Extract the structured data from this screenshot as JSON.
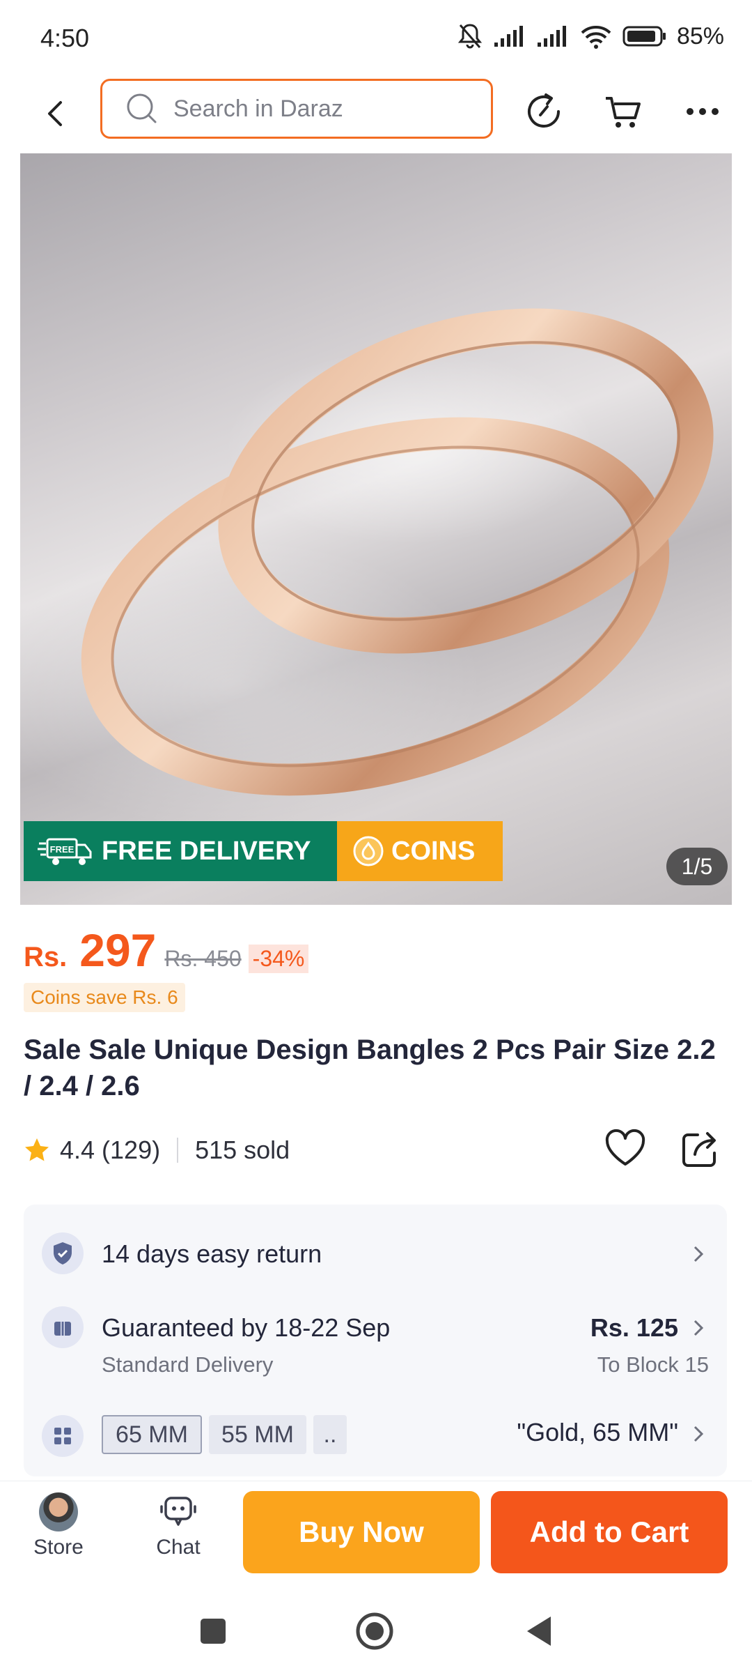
{
  "status_bar": {
    "time": "4:50",
    "battery": "85%",
    "icons": [
      "mute-icon",
      "signal-icon",
      "signal-icon",
      "wifi-icon",
      "battery-icon"
    ]
  },
  "header": {
    "back_icon": "chevron-left-icon",
    "search_placeholder": "Search in Daraz",
    "icons": [
      "history-icon",
      "cart-icon",
      "more-icon"
    ],
    "accent": "#f36d22"
  },
  "gallery": {
    "promo_free_delivery": "FREE DELIVERY",
    "promo_free_tag": "FREE",
    "promo_coins": "COINS",
    "counter": "1/5"
  },
  "price": {
    "currency": "Rs.",
    "current": "297",
    "original": "Rs. 450",
    "discount": "-34%",
    "coins_save": "Coins save Rs. 6",
    "color": "#f4581c"
  },
  "product": {
    "title": "Sale Sale Unique Design Bangles 2 Pcs Pair Size 2.2 / 2.4 / 2.6",
    "rating": "4.4",
    "rating_count": "(129)",
    "sold": "515 sold"
  },
  "info": {
    "return_text": "14 days easy return",
    "delivery_text": "Guaranteed by 18-22 Sep",
    "delivery_sub": "Standard Delivery",
    "delivery_price": "Rs. 125",
    "delivery_to": "To Block 15",
    "variants": [
      "65 MM",
      "55 MM",
      ".."
    ],
    "selected_variant": "\"Gold, 65 MM\""
  },
  "bottom_bar": {
    "store_label": "Store",
    "chat_label": "Chat",
    "buy_now": "Buy Now",
    "add_to_cart": "Add to Cart",
    "buy_color": "#fba41c",
    "cart_color": "#f4561b"
  }
}
